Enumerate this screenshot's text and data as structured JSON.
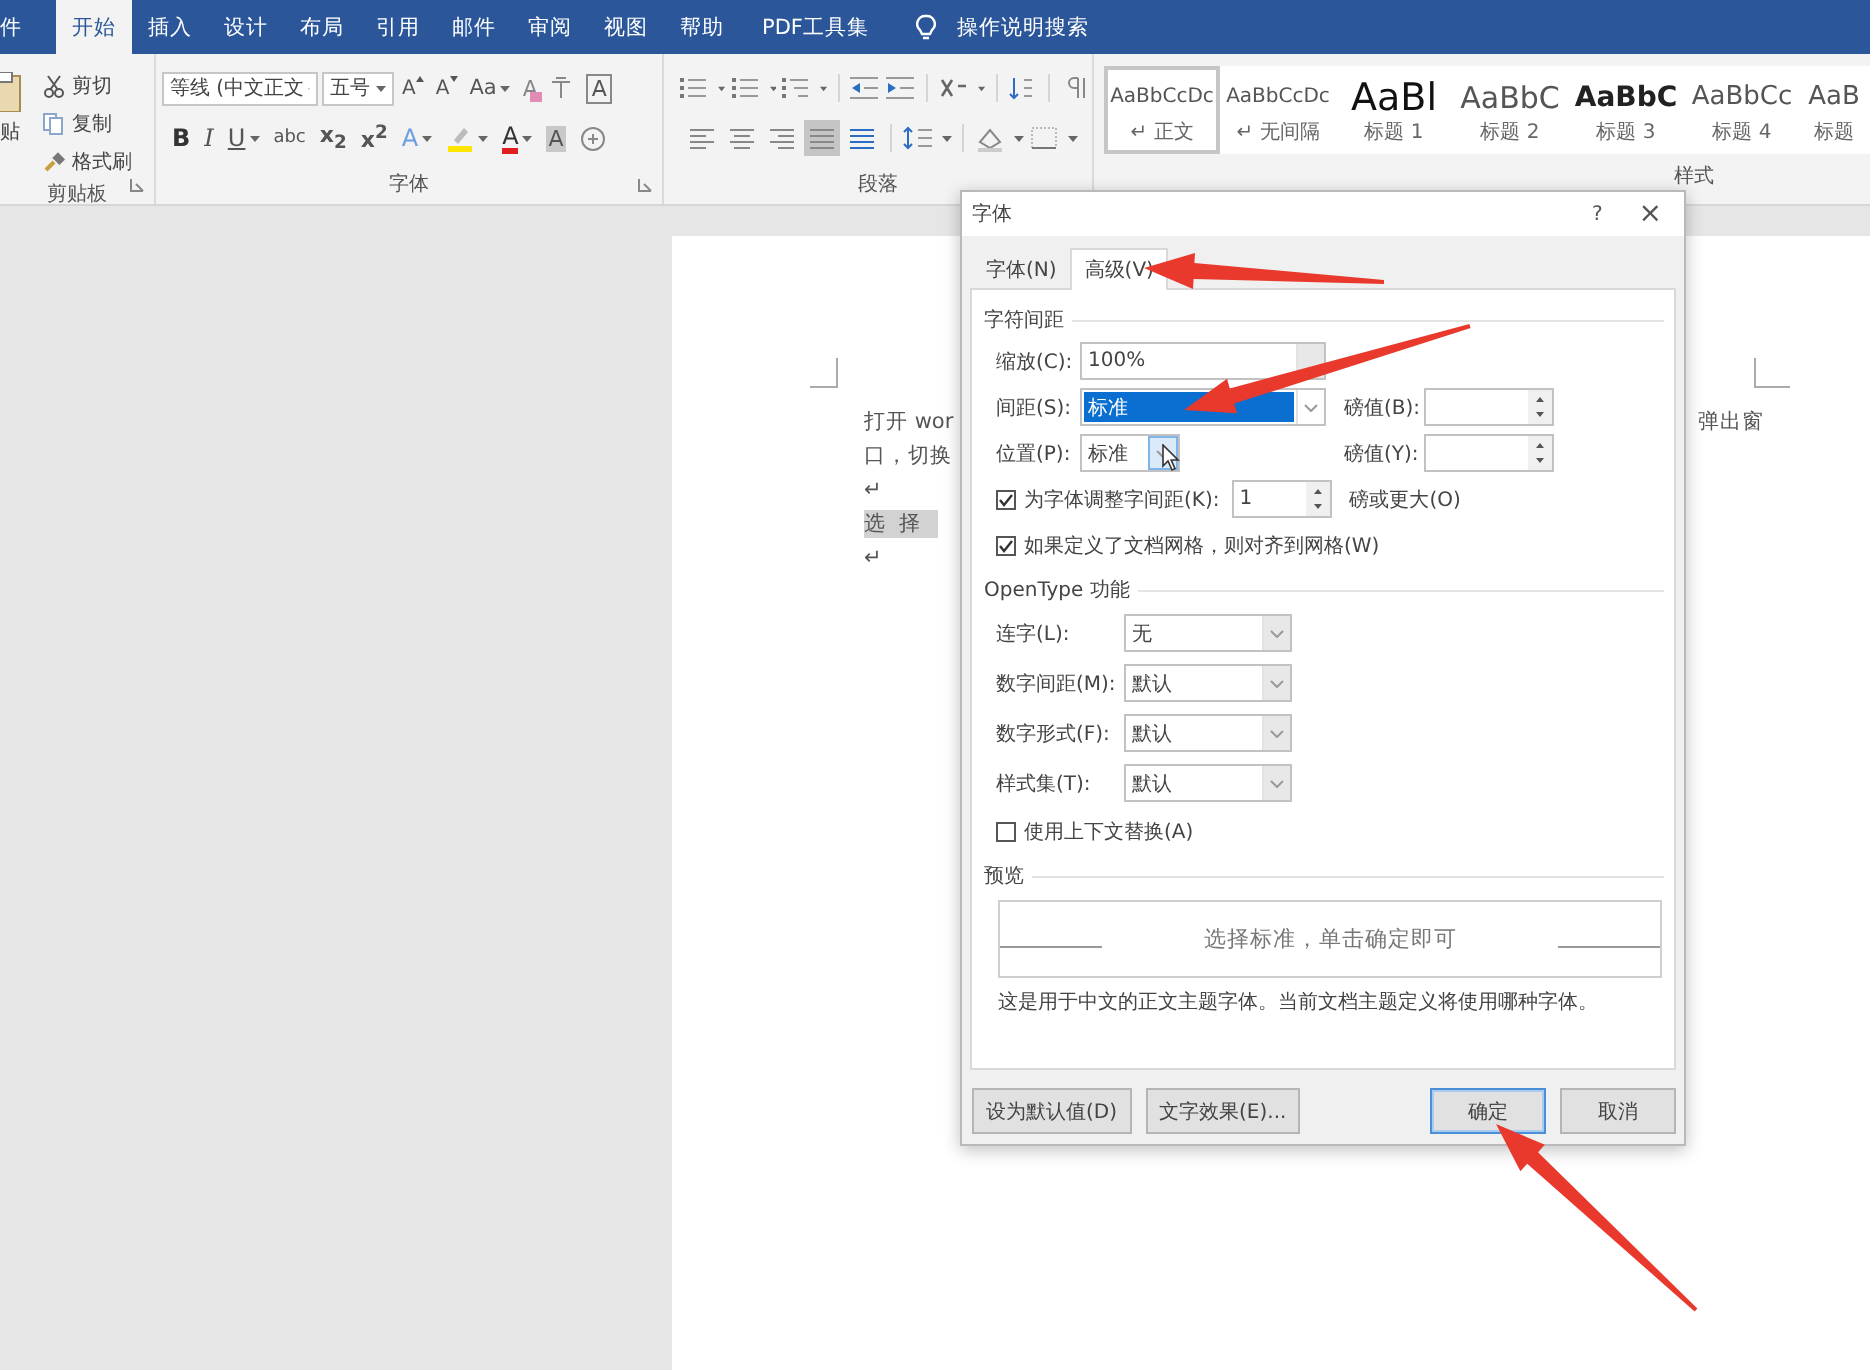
{
  "ribbon": {
    "tabs": [
      {
        "label": "件",
        "selected": false
      },
      {
        "label": "开始",
        "selected": true
      },
      {
        "label": "插入",
        "selected": false
      },
      {
        "label": "设计",
        "selected": false
      },
      {
        "label": "布局",
        "selected": false
      },
      {
        "label": "引用",
        "selected": false
      },
      {
        "label": "邮件",
        "selected": false
      },
      {
        "label": "审阅",
        "selected": false
      },
      {
        "label": "视图",
        "selected": false
      },
      {
        "label": "帮助",
        "selected": false
      },
      {
        "label": "PDF工具集",
        "selected": false
      }
    ],
    "tell_me": "操作说明搜索",
    "clipboard": {
      "paste_label": "贴",
      "items": [
        {
          "kind": "cut",
          "label": "剪切"
        },
        {
          "kind": "copy",
          "label": "复制"
        },
        {
          "kind": "painter",
          "label": "格式刷"
        }
      ],
      "group_label": "剪贴板"
    },
    "font_group": {
      "row1": [
        {
          "kind": "combo",
          "value": "等线 (中文正文"
        },
        {
          "kind": "combo",
          "value": "五号"
        },
        {
          "kind": "grow",
          "label": "A"
        },
        {
          "kind": "shrink",
          "label": "A"
        },
        {
          "kind": "case",
          "label": "Aa"
        },
        {
          "kind": "clear",
          "label": "A"
        },
        {
          "kind": "phonetic"
        },
        {
          "kind": "boxed",
          "label": "A"
        }
      ],
      "row2": [
        {
          "kind": "bold",
          "label": "B"
        },
        {
          "kind": "italic",
          "label": "I"
        },
        {
          "kind": "underline",
          "label": "U"
        },
        {
          "kind": "strike",
          "label": "abc"
        },
        {
          "kind": "sub",
          "label": "x$_{2}$"
        },
        {
          "kind": "super",
          "label": "x$^{2}$"
        },
        {
          "kind": "effect",
          "label": "A"
        },
        {
          "kind": "highlight"
        },
        {
          "kind": "color",
          "label": "A"
        },
        {
          "kind": "shade",
          "label": "A"
        },
        {
          "kind": "enclose"
        }
      ],
      "group_label": "字体"
    },
    "paragraph": {
      "alignments": [
        {
          "kind": "left",
          "selected": false
        },
        {
          "kind": "center",
          "selected": false
        },
        {
          "kind": "right",
          "selected": false
        },
        {
          "kind": "justify",
          "selected": true
        },
        {
          "kind": "distributed",
          "selected": false
        }
      ],
      "group_label": "段落"
    },
    "styles": {
      "items": [
        {
          "kind": "body",
          "preview": "AaBbCcDc",
          "name": "↵ 正文",
          "selected": true
        },
        {
          "kind": "no-spacing",
          "preview": "AaBbCcDc",
          "name": "↵ 无间隔",
          "selected": false
        },
        {
          "kind": "heading1",
          "preview": "AaBl",
          "name": "标题 1",
          "selected": false
        },
        {
          "kind": "heading2",
          "preview": "AaBbC",
          "name": "标题 2",
          "selected": false
        },
        {
          "kind": "heading3",
          "preview": "AaBbC",
          "name": "标题 3",
          "selected": false
        },
        {
          "kind": "heading4",
          "preview": "AaBbCc",
          "name": "标题 4",
          "selected": false
        },
        {
          "kind": "heading",
          "preview": "AaB",
          "name": "标题",
          "selected": false
        }
      ],
      "group_label": "样式"
    }
  },
  "document": {
    "lines": [
      {
        "text": "打开 wor",
        "end": "弹出窗",
        "highlighted": false
      },
      {
        "text": "口，切换",
        "highlighted": false
      },
      {
        "text": "↵",
        "highlighted": false
      },
      {
        "text": "选  择",
        "highlighted": true
      },
      {
        "text": "↵",
        "highlighted": false
      }
    ]
  },
  "dialog": {
    "title": "字体",
    "help": "?",
    "close": "×",
    "tabs": [
      {
        "label": "字体(N)",
        "selected": false
      },
      {
        "label": "高级(V)",
        "selected": true
      }
    ],
    "spacing_section": {
      "title": "字符间距",
      "scale": {
        "label": "缩放(C):",
        "value": "100%"
      },
      "spacing": {
        "label": "间距(S):",
        "value": "标准",
        "selected": true
      },
      "spacing_points": {
        "label": "磅值(B):"
      },
      "position": {
        "label": "位置(P):",
        "value": "标准"
      },
      "position_points": {
        "label": "磅值(Y):"
      },
      "kerning": {
        "label": "为字体调整字间距(K):",
        "checked": true,
        "value": "1",
        "suffix": "磅或更大(O)"
      },
      "snap_to_grid": {
        "label": "如果定义了文档网格，则对齐到网格(W)",
        "checked": true
      }
    },
    "opentype_section": {
      "title": "OpenType 功能",
      "rows": [
        {
          "label": "连字(L):",
          "value": "无"
        },
        {
          "label": "数字间距(M):",
          "value": "默认"
        },
        {
          "label": "数字形式(F):",
          "value": "默认"
        },
        {
          "label": "样式集(T):",
          "value": "默认"
        }
      ],
      "contextual": {
        "label": "使用上下文替换(A)",
        "checked": false
      }
    },
    "preview_section": {
      "title": "预览",
      "sample": "选择标准，单击确定即可",
      "note": "这是用于中文的正文主题字体。当前文档主题定义将使用哪种字体。"
    },
    "left_buttons": [
      {
        "label": "设为默认值(D)",
        "default": false
      },
      {
        "label": "文字效果(E)...",
        "default": false
      }
    ],
    "right_buttons": [
      {
        "label": "确定",
        "default": true
      },
      {
        "label": "取消",
        "default": false
      }
    ]
  }
}
